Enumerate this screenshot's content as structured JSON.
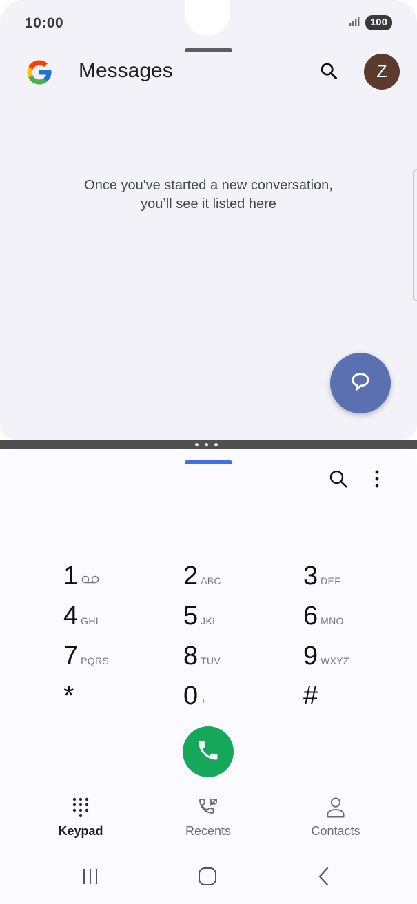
{
  "status_bar": {
    "time": "10:00",
    "battery": "100"
  },
  "messages": {
    "title": "Messages",
    "empty_state_line1": "Once you've started a new conversation,",
    "empty_state_line2": "you’ll see it listed here",
    "avatar_initial": "Z"
  },
  "phone": {
    "keys": [
      {
        "digit": "1",
        "letters": ""
      },
      {
        "digit": "2",
        "letters": "ABC"
      },
      {
        "digit": "3",
        "letters": "DEF"
      },
      {
        "digit": "4",
        "letters": "GHI"
      },
      {
        "digit": "5",
        "letters": "JKL"
      },
      {
        "digit": "6",
        "letters": "MNO"
      },
      {
        "digit": "7",
        "letters": "PQRS"
      },
      {
        "digit": "8",
        "letters": "TUV"
      },
      {
        "digit": "9",
        "letters": "WXYZ"
      },
      {
        "digit": "*",
        "letters": ""
      },
      {
        "digit": "0",
        "letters": "+"
      },
      {
        "digit": "#",
        "letters": ""
      }
    ],
    "tabs": [
      {
        "label": "Keypad",
        "icon": "keypad-icon",
        "active": true
      },
      {
        "label": "Recents",
        "icon": "recents-icon",
        "active": false
      },
      {
        "label": "Contacts",
        "icon": "contacts-icon",
        "active": false
      }
    ]
  },
  "colors": {
    "fab": "#5b70b0",
    "call": "#15a85a",
    "avatar": "#5c3b2f",
    "active_handle": "#3c73e0"
  }
}
